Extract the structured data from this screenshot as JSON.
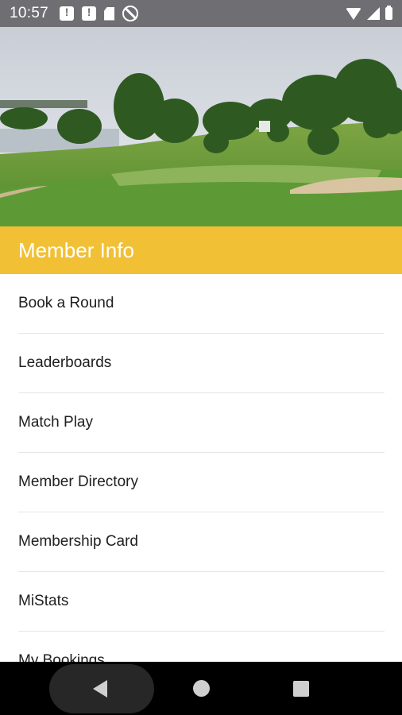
{
  "status_bar": {
    "time": "10:57",
    "left_icons": [
      "message-alert-icon",
      "message-alert-icon",
      "sd-card-icon",
      "no-sync-icon"
    ],
    "right_icons": [
      "wifi-icon",
      "signal-icon",
      "battery-icon"
    ]
  },
  "hero": {
    "image": "golf-course-photo"
  },
  "section": {
    "title": "Member Info",
    "color": "#f2c035"
  },
  "menu": {
    "items": [
      {
        "label": "Book a Round"
      },
      {
        "label": "Leaderboards"
      },
      {
        "label": "Match Play"
      },
      {
        "label": "Member Directory"
      },
      {
        "label": "Membership Card"
      },
      {
        "label": "MiStats"
      },
      {
        "label": "My Bookings"
      }
    ]
  },
  "nav_bar": {
    "icons": [
      "back-icon",
      "home-icon",
      "recents-icon"
    ]
  }
}
